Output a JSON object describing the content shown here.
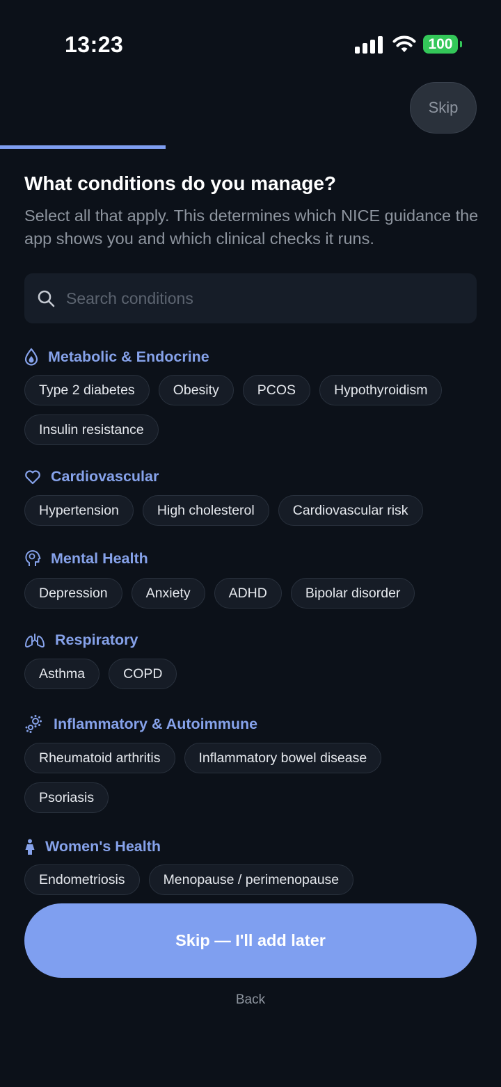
{
  "status_bar": {
    "time": "13:23",
    "battery": "100"
  },
  "header": {
    "skip_label": "Skip",
    "progress_fraction": 0.33
  },
  "page": {
    "title": "What conditions do you manage?",
    "subtitle": "Select all that apply. This determines which NICE guidance the app shows you and which clinical checks it runs."
  },
  "search": {
    "placeholder": "Search conditions"
  },
  "sections": [
    {
      "label": "Metabolic & Endocrine",
      "icon": "droplet-icon",
      "chips": [
        "Type 2 diabetes",
        "Obesity",
        "PCOS",
        "Hypothyroidism",
        "Insulin resistance"
      ]
    },
    {
      "label": "Cardiovascular",
      "icon": "heart-icon",
      "chips": [
        "Hypertension",
        "High cholesterol",
        "Cardiovascular risk"
      ]
    },
    {
      "label": "Mental Health",
      "icon": "head-brain-icon",
      "chips": [
        "Depression",
        "Anxiety",
        "ADHD",
        "Bipolar disorder"
      ]
    },
    {
      "label": "Respiratory",
      "icon": "lungs-icon",
      "chips": [
        "Asthma",
        "COPD"
      ]
    },
    {
      "label": "Inflammatory & Autoimmune",
      "icon": "virus-icon",
      "chips": [
        "Rheumatoid arthritis",
        "Inflammatory bowel disease",
        "Psoriasis"
      ]
    },
    {
      "label": "Women's Health",
      "icon": "person-female-icon",
      "chips": [
        "Endometriosis",
        "Menopause / perimenopause"
      ]
    }
  ],
  "footer": {
    "primary_label": "Skip — I'll add later",
    "back_label": "Back"
  },
  "colors": {
    "background": "#0c1119",
    "accent": "#7f9ff0",
    "section_label": "#86a2ea",
    "chip_bg": "#161c26"
  }
}
